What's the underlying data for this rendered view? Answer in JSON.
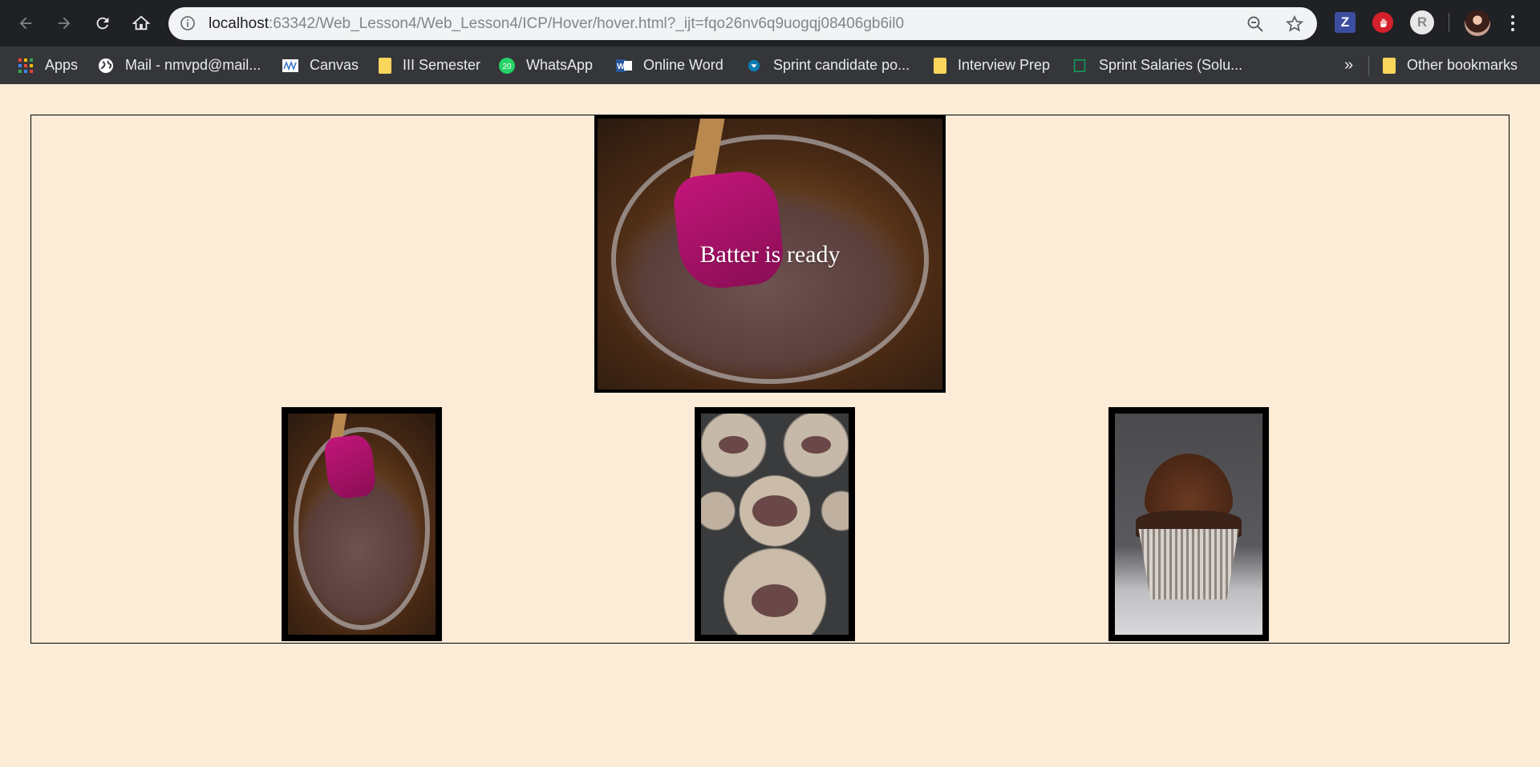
{
  "browser": {
    "url_host": "localhost",
    "url_rest": ":63342/Web_Lesson4/Web_Lesson4/ICP/Hover/hover.html?_ijt=fqo26nv6q9uogqj08406gb6il0",
    "bookmarks": [
      {
        "label": "Apps",
        "icon": "apps-grid-icon"
      },
      {
        "label": "Mail - nmvpd@mail...",
        "icon": "globe-icon"
      },
      {
        "label": "Canvas",
        "icon": "canvas-icon"
      },
      {
        "label": "III Semester",
        "icon": "folder-icon"
      },
      {
        "label": "WhatsApp",
        "icon": "whatsapp-icon"
      },
      {
        "label": "Online Word",
        "icon": "word-icon"
      },
      {
        "label": "Sprint candidate po...",
        "icon": "sprint-icon"
      },
      {
        "label": "Interview Prep",
        "icon": "folder-icon"
      },
      {
        "label": "Sprint Salaries (Solu...",
        "icon": "sheets-icon"
      }
    ],
    "overflow_label": "»",
    "other_bookmarks": "Other bookmarks",
    "whatsapp_badge": "20",
    "ext_z_label": "Z",
    "ext_g_label": "R"
  },
  "page": {
    "hero_caption": "Batter is ready"
  },
  "colors": {
    "page_background": "#fbebd7",
    "toolbar": "#202124",
    "bookmarks_bar": "#35363a"
  }
}
